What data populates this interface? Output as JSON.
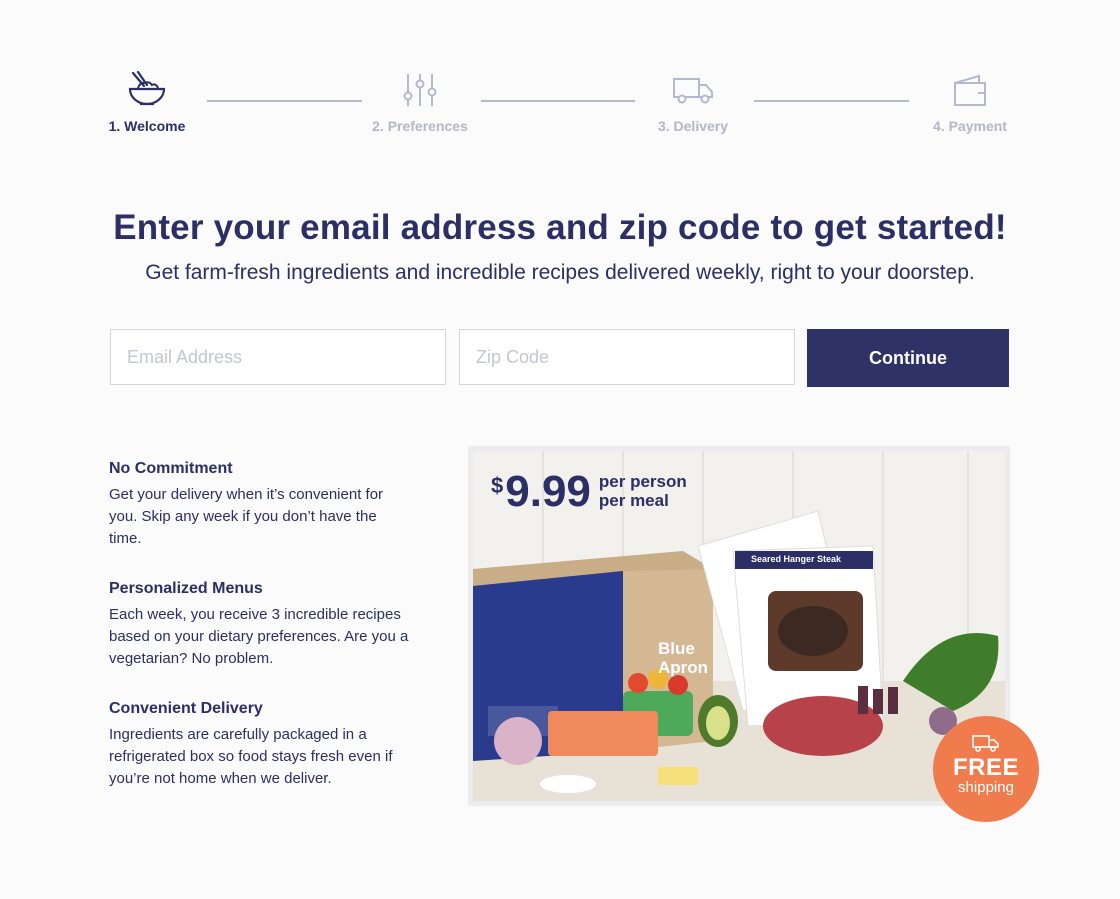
{
  "stepper": {
    "steps": [
      {
        "label": "1. Welcome",
        "icon": "bowl-icon",
        "active": true
      },
      {
        "label": "2. Preferences",
        "icon": "sliders-icon",
        "active": false
      },
      {
        "label": "3. Delivery",
        "icon": "truck-icon",
        "active": false
      },
      {
        "label": "4. Payment",
        "icon": "wallet-icon",
        "active": false
      }
    ]
  },
  "hero": {
    "headline": "Enter your email address and zip code to get started!",
    "subline": "Get farm-fresh ingredients and incredible recipes delivered weekly, right to your doorstep."
  },
  "form": {
    "email_placeholder": "Email Address",
    "email_value": "",
    "zip_placeholder": "Zip Code",
    "zip_value": "",
    "continue_label": "Continue"
  },
  "features": [
    {
      "title": "No Commitment",
      "text": "Get your delivery when it’s convenient for you. Skip any week if you don’t have the time."
    },
    {
      "title": "Personalized Menus",
      "text": "Each week, you receive 3 incredible recipes based on your dietary preferences. Are you a vegetarian? No problem."
    },
    {
      "title": "Convenient Delivery",
      "text": "Ingredients are carefully packaged in a refrigerated box so food stays fresh even if you’re not home when we deliver."
    }
  ],
  "promo": {
    "currency": "$",
    "price": "9.99",
    "per_line1": "per person",
    "per_line2": "per meal",
    "box_brand_line1": "Blue",
    "box_brand_line2": "Apron",
    "recipe_card_title": "Seared Hanger Steak",
    "badge_big": "FREE",
    "badge_small": "shipping"
  },
  "colors": {
    "brand_navy": "#2e3267",
    "text_navy": "#2b2f66",
    "inactive_gray": "#b5b7c3",
    "badge_orange": "#f07c4e",
    "background": "#fbfbfb"
  }
}
